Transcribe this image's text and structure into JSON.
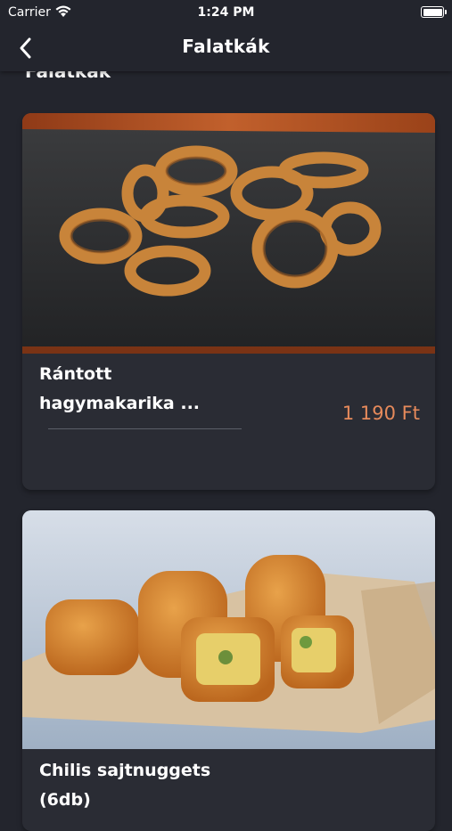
{
  "status_bar": {
    "carrier": "Carrier",
    "time": "1:24 PM"
  },
  "nav": {
    "title": "Falatkák",
    "back_icon": "chevron-left-icon"
  },
  "section": {
    "heading": "Falatkák"
  },
  "products": [
    {
      "name_line1": "Rántott",
      "name_line2": "hagymakarika ...",
      "price": "1 190 Ft",
      "image": "onion-rings-photo"
    },
    {
      "name_line1": "Chilis sajtnuggets",
      "name_line2": "(6db)",
      "image": "cheese-nuggets-photo"
    }
  ],
  "colors": {
    "background": "#23252d",
    "card": "#2a2c34",
    "price": "#e68a5b"
  }
}
